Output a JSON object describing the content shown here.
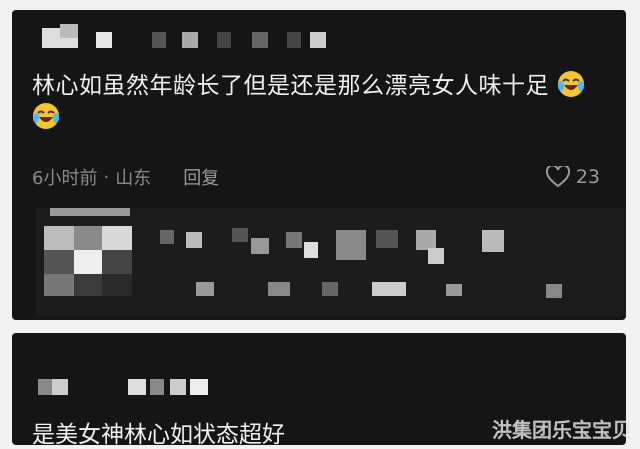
{
  "comment": {
    "text": "林心如虽然年龄长了但是还是那么漂亮女人味十足",
    "emoji": [
      "laughing-crying-emoji",
      "laughing-crying-emoji"
    ],
    "time": "6小时前",
    "separator": "·",
    "location": "山东",
    "reply_label": "回复",
    "likes": "23"
  },
  "second_comment": {
    "text": "是美女神林心如状态超好"
  },
  "watermark": "洪集团乐宝宝贝",
  "colors": {
    "background": "#151515",
    "text": "#f0f0f0",
    "meta": "#8a8a8a"
  }
}
